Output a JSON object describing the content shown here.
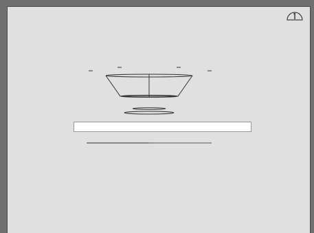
{
  "window": {
    "background_color": "#707070",
    "panel_color": "#e0e0e0"
  },
  "info_button": {
    "icon": "info-gauge-icon"
  },
  "artwork": {
    "icon": "wireframe-dish-icon"
  },
  "input": {
    "value": "",
    "placeholder": "",
    "border_color": "#8a8aff"
  },
  "progress": {
    "fraction": 0.5
  }
}
